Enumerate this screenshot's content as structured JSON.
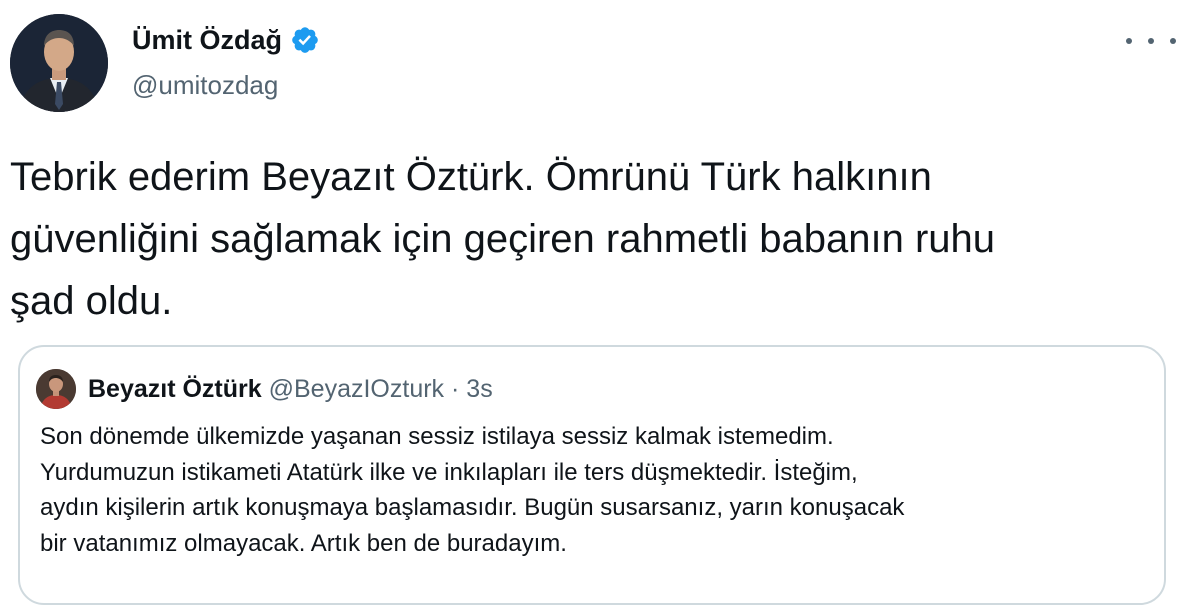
{
  "tweet": {
    "author_name": "Ümit Özdağ",
    "author_handle": "@umitozdag",
    "text": "Tebrik ederim Beyazıt Öztürk. Ömrünü Türk halkının\ngüvenliğini sağlamak için geçiren rahmetli babanın ruhu\nşad oldu.",
    "verified_icon": "verified-badge-icon",
    "more_icon": "more-options-icon"
  },
  "quote": {
    "author_name": "Beyazıt Öztürk",
    "author_handle": "@BeyazIOzturk",
    "separator": "·",
    "time": "3s",
    "text": "Son dönemde ülkemizde yaşanan sessiz istilaya sessiz kalmak istemedim.\nYurdumuzun istikameti Atatürk ilke ve inkılapları ile ters düşmektedir. İsteğim,\naydın kişilerin artık konuşmaya başlamasıdır. Bugün susarsanız, yarın konuşacak\nbir vatanımız olmayacak. Artık ben de buradayım."
  },
  "colors": {
    "verified": "#1d9bf0",
    "text_primary": "#0f1419",
    "text_secondary": "#536471",
    "border": "#cfd9de"
  }
}
